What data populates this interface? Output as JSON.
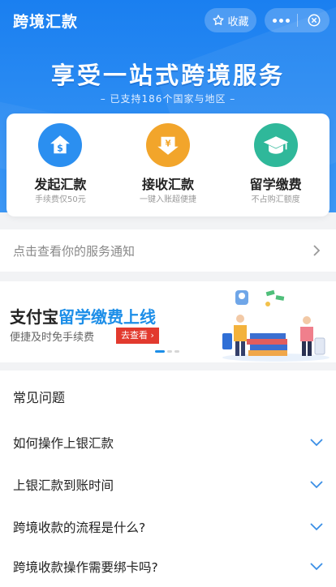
{
  "header": {
    "title": "跨境汇款",
    "favorite_label": "收藏"
  },
  "banner": {
    "title": "享受一站式跨境服务",
    "subtitle": "– 已支持186个国家与地区 –"
  },
  "services": [
    {
      "label": "发起汇款",
      "desc": "手续费仅50元",
      "color": "#2b8ff0"
    },
    {
      "label": "接收汇款",
      "desc": "一键入账超便捷",
      "color": "#f2a52b"
    },
    {
      "label": "留学缴费",
      "desc": "不占购汇额度",
      "color": "#2fb89a"
    }
  ],
  "notice": {
    "text": "点击查看你的服务通知"
  },
  "promo": {
    "title_prefix": "支付宝",
    "title_highlight": "留学缴费上线",
    "subtitle": "便捷及时免手续费",
    "button": "去查看 ›"
  },
  "faq": {
    "heading": "常见问题",
    "items": [
      {
        "question": "如何操作上银汇款"
      },
      {
        "question": "上银汇款到账时间"
      },
      {
        "question": "跨境收款的流程是什么?"
      },
      {
        "question": "跨境收款操作需要绑卡吗?"
      }
    ]
  }
}
